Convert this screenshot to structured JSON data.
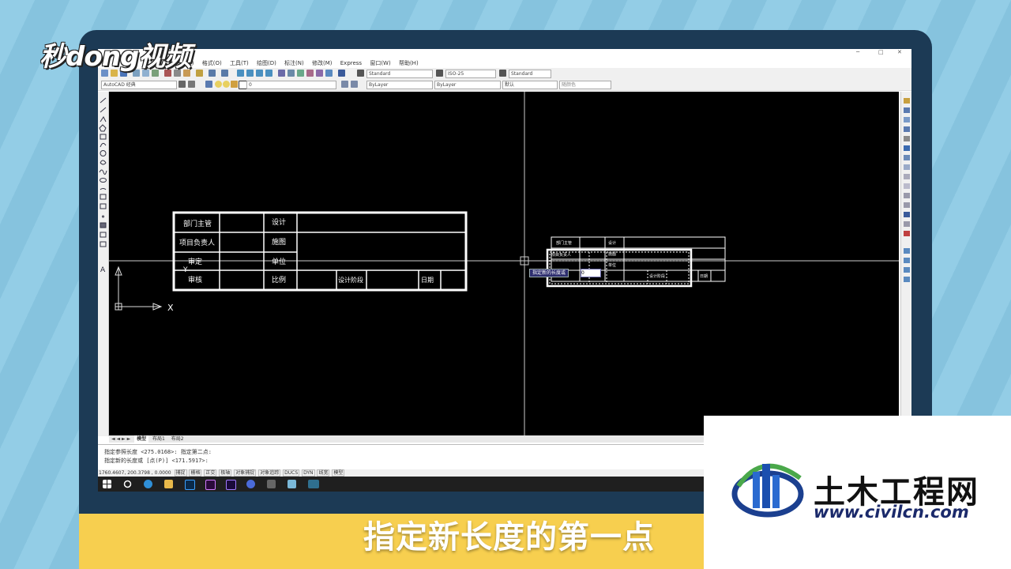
{
  "overlay": {
    "logo_text": "秒dong视频",
    "caption": "指定新长度的第一点",
    "watermark_title": "土木工程网",
    "watermark_url": "www.civilcn.com"
  },
  "menubar": [
    "插入(I)",
    "格式(O)",
    "工具(T)",
    "绘图(D)",
    "标注(N)",
    "修改(M)",
    "Express",
    "窗口(W)",
    "帮助(H)"
  ],
  "toolbar": {
    "text_style": "Standard",
    "dim_style": "ISO-25",
    "table_style": "Standard",
    "workspace": "AutoCAD 经典",
    "layer": "0",
    "color": "ByLayer",
    "linetype": "ByLayer",
    "lineweight": "默认",
    "plotstyle": "随颜色"
  },
  "table": {
    "c1": [
      "部门主管",
      "项目负责人",
      "审定",
      "审核"
    ],
    "c3": [
      "设计",
      "施图",
      "单位",
      "比例"
    ],
    "stage": "设计阶段",
    "date": "日期"
  },
  "small_table": {
    "c1": [
      "部门主管",
      "项目负责人"
    ],
    "c3": [
      "设计",
      "施图",
      "单位"
    ],
    "stage": "设计阶段",
    "date": "日期"
  },
  "axis": {
    "x": "X",
    "y": "Y"
  },
  "dynamic_prompt": {
    "label": "指定新的长度或",
    "value": "0"
  },
  "layout_tabs": [
    "模型",
    "布局1",
    "布局2"
  ],
  "command_lines": [
    "指定参照长度 <275.0168>:  指定第二点:",
    "指定新的长度或 [点(P)] <171.5917>:"
  ],
  "status": {
    "coords": "1760.4607, 200.3798 , 0.0000",
    "toggles": [
      "捕捉",
      "栅格",
      "正交",
      "极轴",
      "对象捕捉",
      "对象追踪",
      "DUCS",
      "DYN",
      "线宽",
      "模型"
    ]
  },
  "window_controls": [
    "─",
    "□",
    "✕"
  ]
}
